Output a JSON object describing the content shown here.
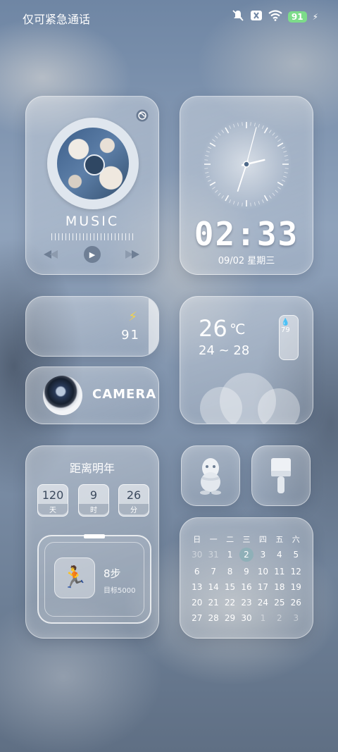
{
  "status": {
    "carrier": "仅可紧急通话",
    "battery": "91"
  },
  "music": {
    "label": "MUSIC"
  },
  "clock": {
    "time": "02:33",
    "date": "09/02  星期三",
    "hour": 2,
    "minute": 33,
    "second": 0
  },
  "battery_widget": {
    "value": "91"
  },
  "camera": {
    "label": "CAMERA"
  },
  "weather": {
    "temp": "26",
    "unit": "℃",
    "range": "24 ~ 28",
    "humidity": "79"
  },
  "countdown": {
    "title": "距离明年",
    "days": "120",
    "days_unit": "天",
    "hours": "9",
    "hours_unit": "时",
    "minutes": "26",
    "minutes_unit": "分",
    "steps": "8步",
    "goal": "目标5000"
  },
  "calendar": {
    "headers": [
      "日",
      "一",
      "二",
      "三",
      "四",
      "五",
      "六"
    ],
    "rows": [
      [
        "30",
        "31",
        "1",
        "2",
        "3",
        "4",
        "5"
      ],
      [
        "6",
        "7",
        "8",
        "9",
        "10",
        "11",
        "12"
      ],
      [
        "13",
        "14",
        "15",
        "16",
        "17",
        "18",
        "19"
      ],
      [
        "20",
        "21",
        "22",
        "23",
        "24",
        "25",
        "26"
      ],
      [
        "27",
        "28",
        "29",
        "30",
        "1",
        "2",
        "3"
      ]
    ],
    "today": "2"
  },
  "icons": {
    "qq": "qq-penguin-icon",
    "brush": "brush-icon"
  }
}
